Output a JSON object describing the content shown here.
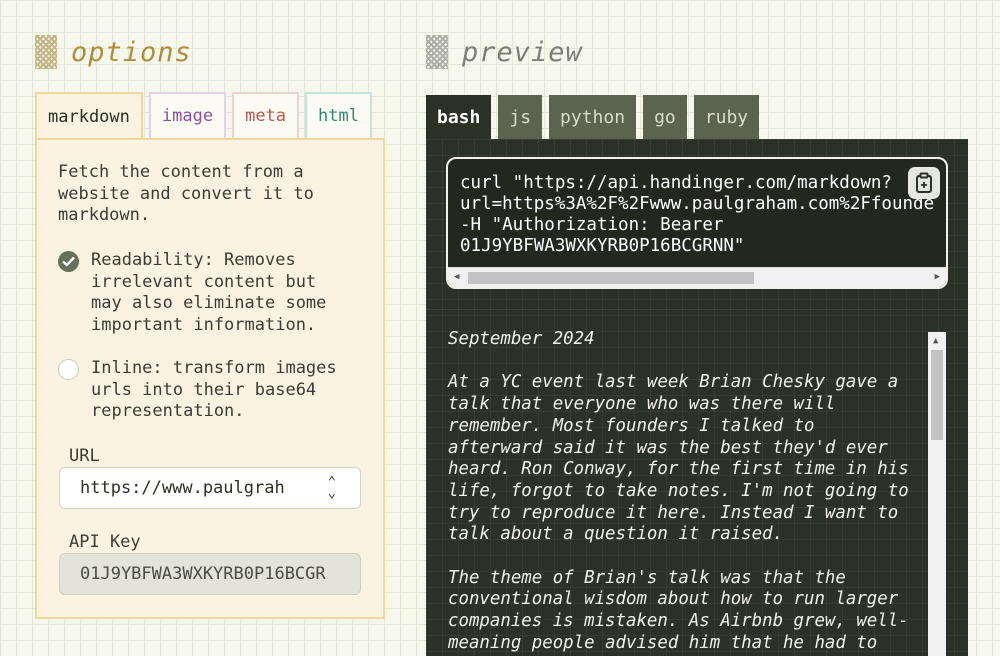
{
  "options": {
    "title": "options",
    "tabs": [
      {
        "label": "markdown",
        "active": true,
        "color": "#2b2f24"
      },
      {
        "label": "image",
        "active": false,
        "color": "#8c4ea3"
      },
      {
        "label": "meta",
        "active": false,
        "color": "#c1574a"
      },
      {
        "label": "html",
        "active": false,
        "color": "#2c8a73"
      }
    ],
    "description": "Fetch the content from a\nwebsite and convert it to\nmarkdown.",
    "readability": {
      "checked": true,
      "text": "Readability: Removes\nirrelevant content but\nmay also eliminate some\nimportant information."
    },
    "inline": {
      "checked": false,
      "text": "Inline: transform images\nurls into their base64\nrepresentation."
    },
    "url": {
      "label": "URL",
      "value": "https://www.paulgrah"
    },
    "api_key": {
      "label": "API Key",
      "value": "01J9YBFWA3WXKYRB0P16BCGR"
    }
  },
  "preview": {
    "title": "preview",
    "tabs": [
      {
        "label": "bash",
        "active": true
      },
      {
        "label": "js",
        "active": false
      },
      {
        "label": "python",
        "active": false
      },
      {
        "label": "go",
        "active": false
      },
      {
        "label": "ruby",
        "active": false
      }
    ],
    "code": "curl \"https://api.handinger.com/markdown?\nurl=https%3A%2F%2Fwww.paulgraham.com%2Ffounde\n-H \"Authorization: Bearer\n01J9YBFWA3WXKYRB0P16BCGRNN\"",
    "copy_icon": "clipboard-icon",
    "article": [
      "September 2024",
      "At a YC event last week Brian Chesky gave a\ntalk that everyone who was there will\nremember. Most founders I talked to\nafterward said it was the best they'd ever\nheard. Ron Conway, for the first time in his\nlife, forgot to take notes. I'm not going to\ntry to reproduce it here. Instead I want to\ntalk about a question it raised.",
      "The theme of Brian's talk was that the\nconventional wisdom about how to run larger\ncompanies is mistaken. As Airbnb grew, well-\nmeaning people advised him that he had to"
    ]
  }
}
